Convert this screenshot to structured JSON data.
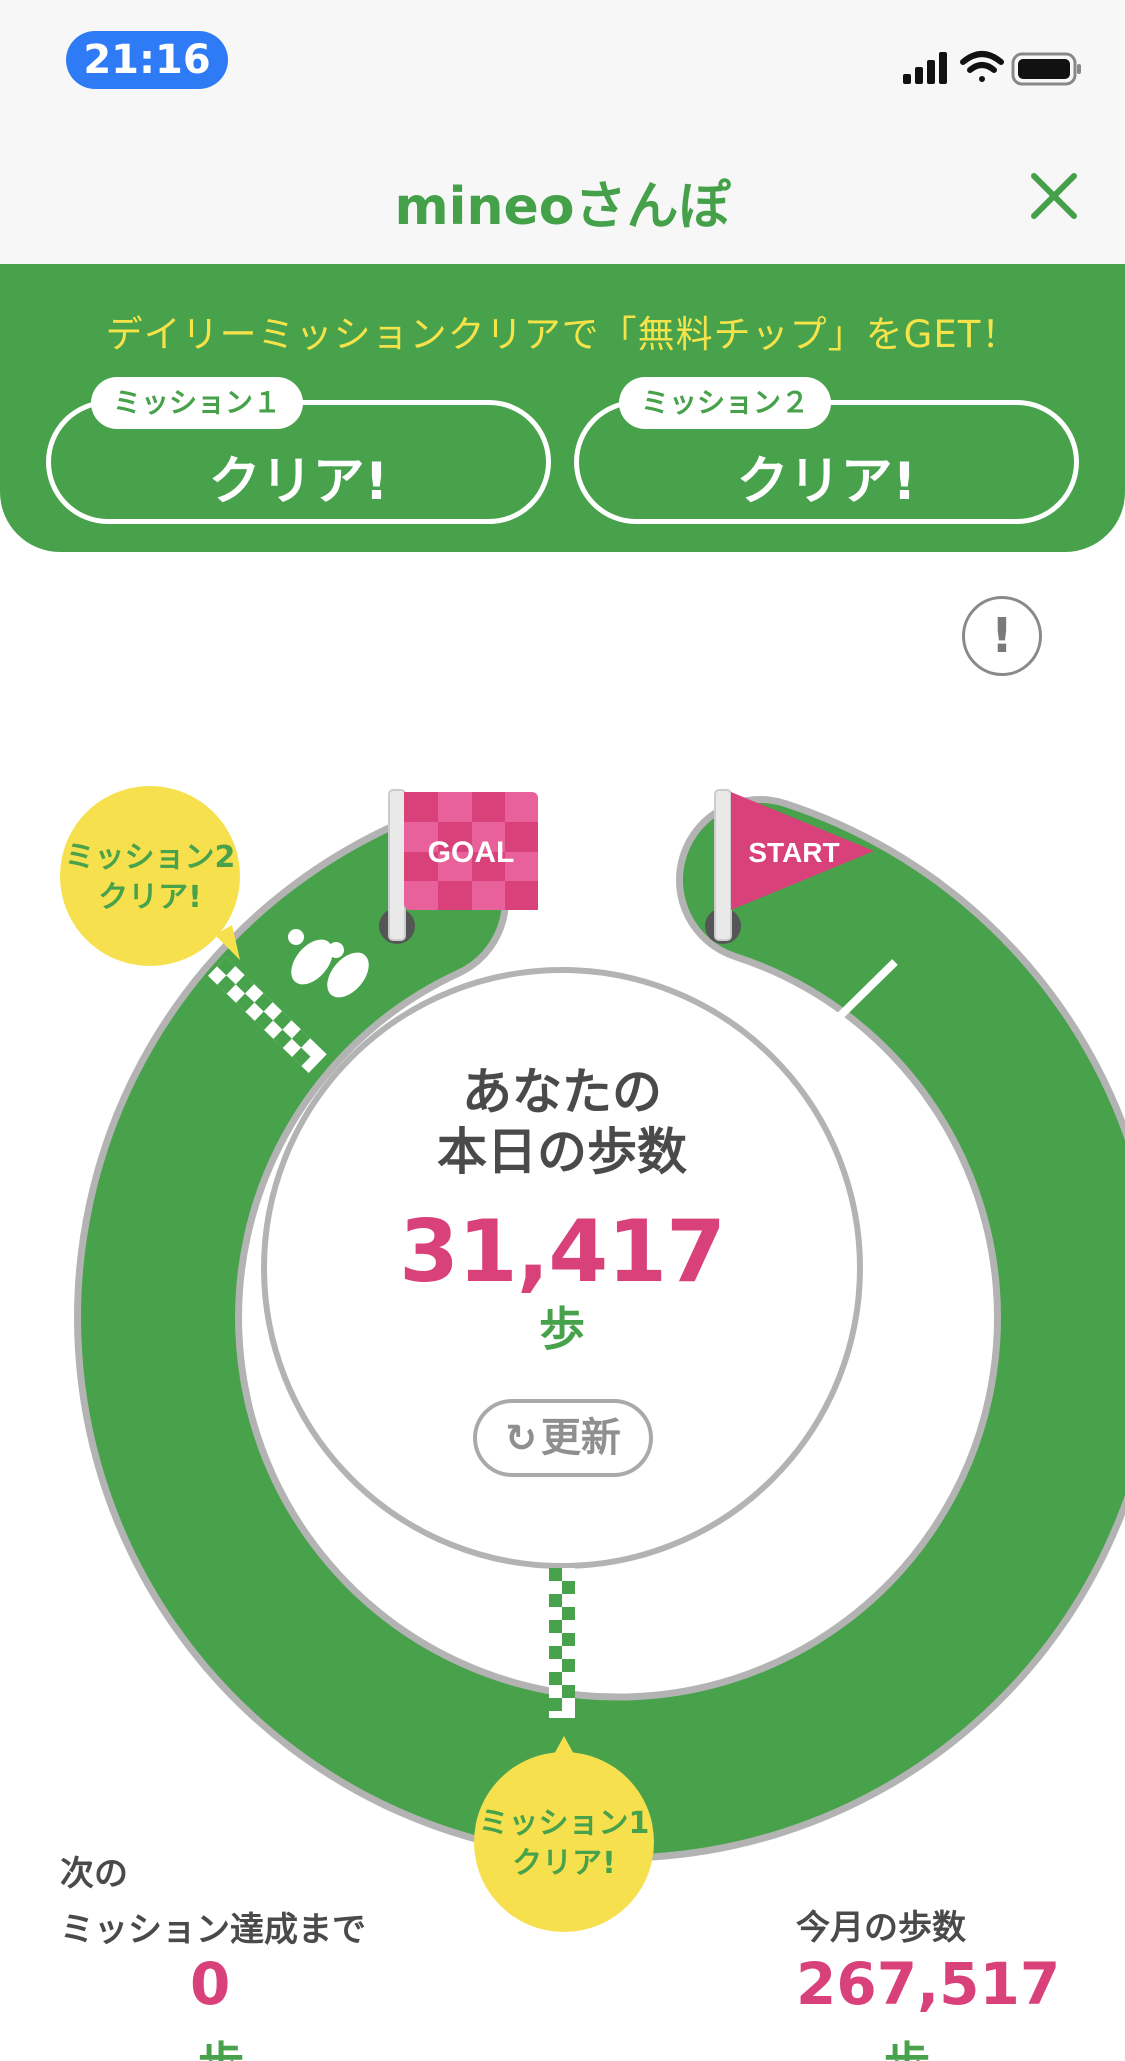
{
  "status_bar": {
    "time": "21:16",
    "signal_icon": "cellular-signal-icon",
    "wifi_icon": "wifi-icon",
    "battery_icon": "battery-icon"
  },
  "nav": {
    "title": "mineoさんぽ",
    "close_icon": "close-icon"
  },
  "banner": {
    "text": "デイリーミッションクリアで「無料チップ」をGET！",
    "missions": [
      {
        "tag": "ミッション１",
        "status": "クリア!"
      },
      {
        "tag": "ミッション２",
        "status": "クリア!"
      }
    ]
  },
  "info_icon": "exclamation-icon",
  "course": {
    "goal_flag": "GOAL",
    "start_flag": "START",
    "footprints_icon": "footprints-icon",
    "bubble_mission2": {
      "line1": "ミッション2",
      "line2": "クリア!"
    },
    "bubble_mission1": {
      "line1": "ミッション1",
      "line2": "クリア!"
    },
    "center_label_line1": "あなたの",
    "center_label_line2": "本日の歩数",
    "today_steps": "31,417",
    "step_unit": "歩",
    "refresh_label": "更新",
    "refresh_icon": "refresh-icon"
  },
  "stats": {
    "next_label_line1": "次の",
    "next_label_line2": "ミッション達成まで",
    "next_value": "0",
    "next_unit": "歩",
    "month_label": "今月の歩数",
    "month_value": "267,517",
    "month_unit": "歩"
  },
  "colors": {
    "green": "#47a24b",
    "pink": "#d9417a",
    "yellow": "#f7e04d",
    "banner_text": "#f6e34a",
    "blue_pill": "#2f7bf5"
  }
}
